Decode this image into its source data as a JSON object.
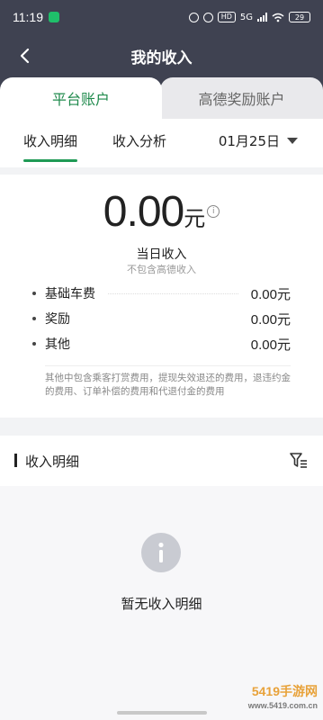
{
  "status_bar": {
    "time": "11:19",
    "battery": "29",
    "network_badge": "HD",
    "signal_label": "5G"
  },
  "header": {
    "title": "我的收入",
    "back_icon": "chevron-left-icon"
  },
  "account_tabs": [
    {
      "label": "平台账户",
      "active": true
    },
    {
      "label": "高德奖励账户",
      "active": false
    }
  ],
  "sub_tabs": [
    {
      "label": "收入明细",
      "active": true
    },
    {
      "label": "收入分析",
      "active": false
    }
  ],
  "date_picker": {
    "value": "01月25日"
  },
  "summary": {
    "amount": "0.00",
    "unit": "元",
    "label": "当日收入",
    "sublabel": "不包含高德收入",
    "items": [
      {
        "name": "基础车费",
        "value": "0.00元"
      },
      {
        "name": "奖励",
        "value": "0.00元"
      },
      {
        "name": "其他",
        "value": "0.00元"
      }
    ],
    "note": "其他中包含乘客打赏费用，提现失效退还的费用，退违约金的费用、订单补偿的费用和代退付金的费用"
  },
  "detail": {
    "title": "收入明细",
    "filter_icon": "filter-icon"
  },
  "empty_state": {
    "icon": "info-icon",
    "text": "暂无收入明细"
  },
  "watermark": {
    "text": "5419手游网",
    "domain": "www.5419.com.cn"
  },
  "colors": {
    "header_bg": "#3f4251",
    "accent": "#1f8a4c",
    "page_bg": "#f2f3f5"
  }
}
